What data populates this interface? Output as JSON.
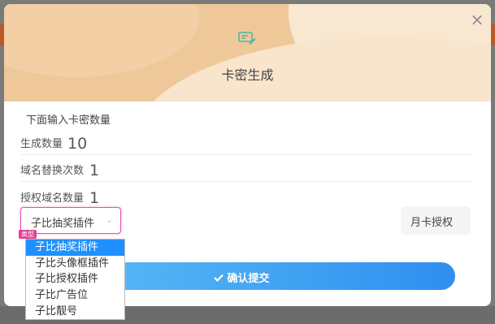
{
  "dialog": {
    "title": "卡密生成",
    "close": "×",
    "header_icon": "card-edit-icon"
  },
  "form": {
    "section_label": "下面输入卡密数量",
    "rows": [
      {
        "label": "生成数量",
        "value": "10"
      },
      {
        "label": "域名替换次数",
        "value": "1"
      },
      {
        "label": "授权域名数量",
        "value": "1"
      }
    ],
    "plugin_select": {
      "value": "子比抽奖插件",
      "tag": "类型",
      "options": [
        "子比抽奖插件",
        "子比头像框插件",
        "子比授权插件",
        "子比广告位",
        "子比靓号"
      ],
      "selected_index": 0
    },
    "card_type": "月卡授权"
  },
  "submit": {
    "label": "确认提交"
  },
  "colors": {
    "header": "#efc89a",
    "accent_pink": "#e54bb0",
    "button_start": "#5ec1f7",
    "button_end": "#2f8ef0",
    "selected_option": "#1e90ff"
  }
}
